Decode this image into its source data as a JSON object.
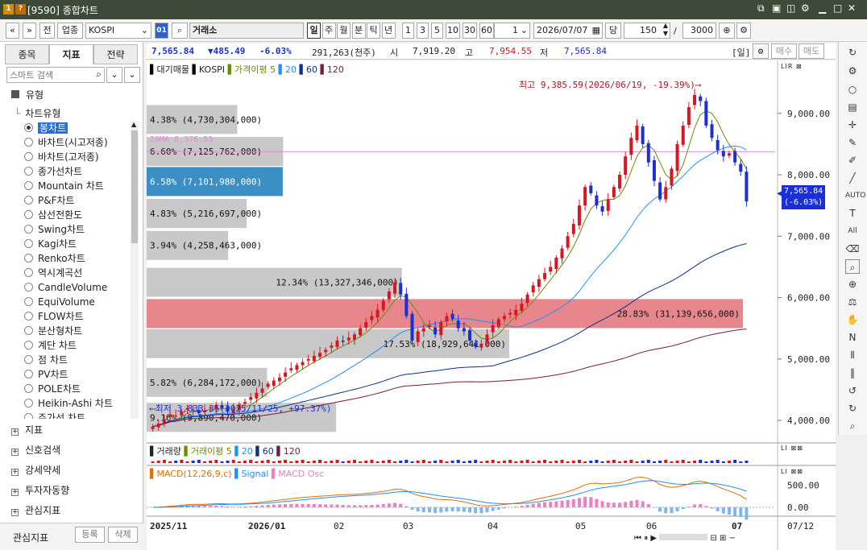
{
  "window": {
    "badge_1": "1",
    "badge_2": "?",
    "title": "[9590] 종합차트"
  },
  "toolbar": {
    "nav_prev": "«",
    "nav_next": "»",
    "full": "전",
    "sector": "업종",
    "symbol": "KOSPI",
    "link_code": "01",
    "exchange": "거래소",
    "periods": [
      "일",
      "주",
      "월",
      "분",
      "틱",
      "년"
    ],
    "active_period": "일",
    "intervals": [
      "1",
      "3",
      "5",
      "10",
      "30",
      "60"
    ],
    "step": "1",
    "date": "2026/07/07",
    "unit": "당",
    "count": "150",
    "slash": "/",
    "total": "3000"
  },
  "left": {
    "tabs": [
      "종목",
      "지표",
      "전략"
    ],
    "active_tab": "지표",
    "search_placeholder": "스마트 검색",
    "section": "유형",
    "sub": "차트유형",
    "chart_types": [
      "봉차트",
      "바차트(시고저종)",
      "바차트(고저종)",
      "종가선차트",
      "Mountain 차트",
      "P&F차트",
      "삼선전환도",
      "Swing차트",
      "Kagi차트",
      "Renko차트",
      "역시계곡선",
      "CandleVolume",
      "EquiVolume",
      "FLOW차트",
      "분산형차트",
      "계단 차트",
      "점 차트",
      "PV차트",
      "POLE차트",
      "Heikin-Ashi 차트",
      "주가선 차트"
    ],
    "groups": [
      "지표",
      "신호검색",
      "강세약세",
      "투자자동향",
      "관심지표"
    ],
    "footer_label": "관심지표",
    "register": "등록",
    "delete": "삭제"
  },
  "quote": {
    "price": "7,565.84",
    "change": "▼485.49",
    "pct": "-6.03%",
    "volume": "291,263(천주)",
    "open_label": "시",
    "open": "7,919.20",
    "high_label": "고",
    "high": "7,954.55",
    "low_label": "저",
    "low": "7,565.84",
    "period_tag": "[일]",
    "buy": "매수",
    "sell": "매도"
  },
  "legend_main": {
    "name": "대기매물",
    "symbol": "KOSPI",
    "ma_label": "가격이평 5",
    "ma20": "20",
    "ma60": "60",
    "ma120": "120"
  },
  "legend_vol": {
    "name": "거래량",
    "ma_label": "거래이평 5",
    "ma20": "20",
    "ma60": "60",
    "ma120": "120"
  },
  "legend_macd": {
    "name": "MACD(12,26,9,c)",
    "signal": "Signal",
    "osc": "MACD Osc"
  },
  "annotations": {
    "high_note": "최고 9,385.59(2026/06/19, -19.39%)",
    "low_note": "최저 3,833.35(2025/11/25, +97.37%)",
    "ma_note": "20MA 8,376.53",
    "last_price": "7,565.84",
    "last_pct": "(-6.03%)"
  },
  "colors": {
    "up": "#d7171f",
    "down": "#1b2fd6",
    "ma5": "#6a8d00",
    "ma20": "#1e90ff",
    "ma60": "#0a2f8f",
    "ma120": "#7a1a3a",
    "profile": "#c8c8c8",
    "profile_max": "#e8868e",
    "profile_cur": "#3b8fc4"
  },
  "chart_data": [
    {
      "type": "candlestick",
      "title": "KOSPI",
      "y_ticks": [
        "9,000.00",
        "8,000.00",
        "7,000.00",
        "6,000.00",
        "5,000.00",
        "4,000.00"
      ],
      "ylim": [
        3700,
        9600
      ],
      "x_ticks": [
        "2025/11",
        "2026/01",
        "02",
        "03",
        "04",
        "05",
        "06",
        "07",
        "07/12"
      ],
      "volume_profile": [
        {
          "label": "4.38% (4,730,304,000)",
          "pct": 4.38,
          "price": 8900
        },
        {
          "label": "6.60% (7,125,762,000)",
          "pct": 6.6,
          "price": 8380
        },
        {
          "label": "6.58% (7,101,980,000)",
          "pct": 6.58,
          "price": 7890
        },
        {
          "label": "4.83% (5,216,697,000)",
          "pct": 4.83,
          "price": 7370
        },
        {
          "label": "3.94% (4,258,463,000)",
          "pct": 3.94,
          "price": 6850
        },
        {
          "label": "12.34% (13,327,346,000)",
          "pct": 12.34,
          "price": 6250
        },
        {
          "label": "28.83% (31,139,656,000)",
          "pct": 28.83,
          "price": 5740
        },
        {
          "label": "17.53% (18,929,641,000)",
          "pct": 17.53,
          "price": 5250
        },
        {
          "label": "5.82% (6,284,172,000)",
          "pct": 5.82,
          "price": 4620
        },
        {
          "label": "9.16% (9,890,470,000)",
          "pct": 9.16,
          "price": 4050
        }
      ],
      "close_series": [
        3900,
        3950,
        4020,
        4100,
        4080,
        4150,
        4200,
        4180,
        4120,
        4160,
        4210,
        4250,
        4200,
        4150,
        4180,
        4260,
        4300,
        4380,
        4450,
        4520,
        4600,
        4650,
        4700,
        4780,
        4850,
        4900,
        4950,
        5000,
        5050,
        5100,
        5150,
        5220,
        5300,
        5280,
        5350,
        5400,
        5500,
        5600,
        5700,
        5800,
        5950,
        6100,
        6250,
        6050,
        5700,
        5300,
        5450,
        5500,
        5550,
        5400,
        5600,
        5700,
        5650,
        5500,
        5450,
        5300,
        5200,
        5250,
        5400,
        5550,
        5650,
        5700,
        5750,
        5800,
        5900,
        6050,
        6200,
        6300,
        6400,
        6500,
        6650,
        6800,
        7000,
        7200,
        7500,
        7800,
        7700,
        7500,
        7400,
        7600,
        7800,
        8000,
        8300,
        8600,
        8800,
        8500,
        8200,
        7900,
        7600,
        7800,
        8100,
        8500,
        8800,
        9100,
        9300,
        9200,
        8800,
        8600,
        8400,
        8300,
        8350,
        8200,
        8051,
        7566
      ],
      "macd_ticks": [
        "500.00",
        "0.00"
      ]
    }
  ]
}
